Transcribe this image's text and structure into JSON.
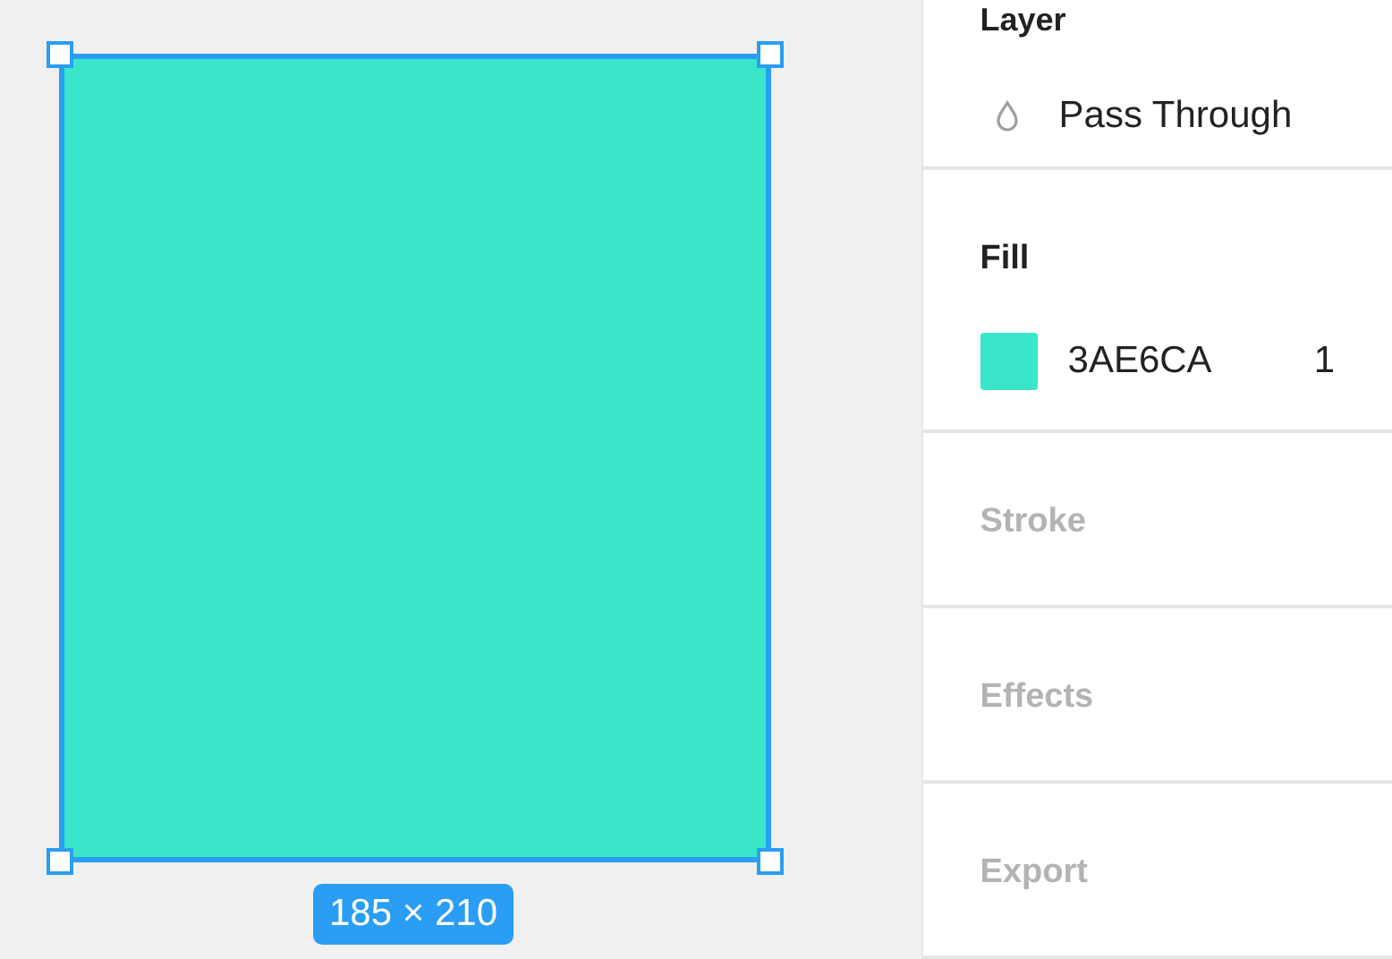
{
  "canvas": {
    "shape": {
      "color": "#3ae6ca",
      "selected": true
    },
    "size_label": "185 × 210"
  },
  "layer": {
    "title": "Layer",
    "blend_mode": "Pass Through"
  },
  "fill": {
    "title": "Fill",
    "color": "#3ae6ca",
    "hex": "3AE6CA",
    "opacity": "1"
  },
  "sections": [
    {
      "title": "Stroke",
      "disabled": true
    },
    {
      "title": "Effects",
      "disabled": true
    },
    {
      "title": "Export",
      "disabled": true
    }
  ]
}
